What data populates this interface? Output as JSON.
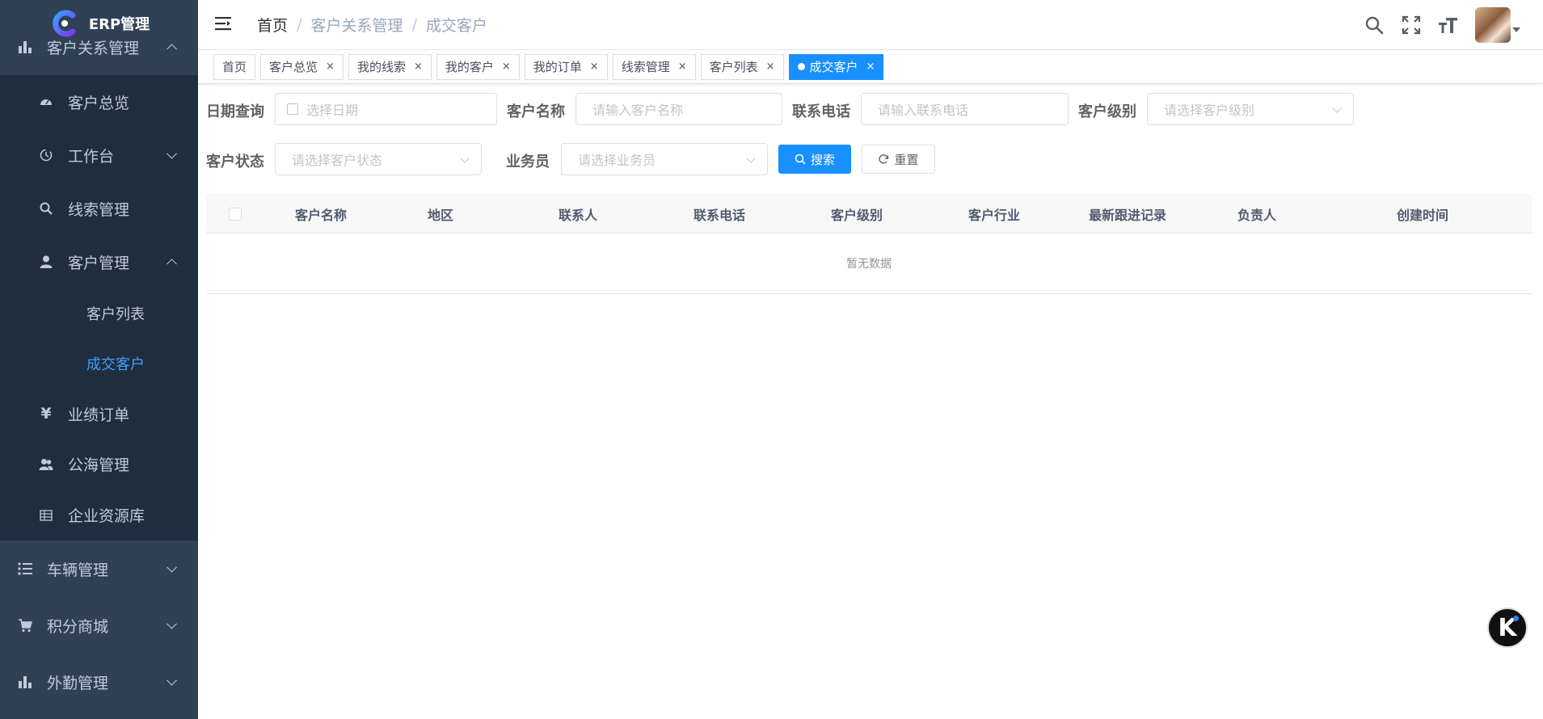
{
  "app": {
    "logo_text": "ERP管理"
  },
  "sidebar": {
    "items": [
      {
        "label": "客户关系管理",
        "icon": "bar-chart-icon",
        "level": "top",
        "expanded": true
      },
      {
        "label": "客户总览",
        "icon": "dashboard-icon",
        "level": "sub"
      },
      {
        "label": "工作台",
        "icon": "history-icon",
        "level": "sub",
        "collapsed": true
      },
      {
        "label": "线索管理",
        "icon": "search-icon",
        "level": "sub"
      },
      {
        "label": "客户管理",
        "icon": "user-icon",
        "level": "sub",
        "expanded": true
      },
      {
        "label": "客户列表",
        "level": "subsub"
      },
      {
        "label": "成交客户",
        "level": "subsub",
        "active": true
      },
      {
        "label": "业绩订单",
        "icon": "yen-icon",
        "level": "sub"
      },
      {
        "label": "公海管理",
        "icon": "users-icon",
        "level": "sub"
      },
      {
        "label": "企业资源库",
        "icon": "table-icon",
        "level": "sub"
      },
      {
        "label": "车辆管理",
        "icon": "list-icon",
        "level": "top"
      },
      {
        "label": "积分商城",
        "icon": "cart-icon",
        "level": "top"
      },
      {
        "label": "外勤管理",
        "icon": "bar-chart-icon",
        "level": "top"
      }
    ]
  },
  "breadcrumb": {
    "home": "首页",
    "level1": "客户关系管理",
    "level2": "成交客户",
    "separator": "/"
  },
  "tags": [
    {
      "label": "首页",
      "closable": false
    },
    {
      "label": "客户总览",
      "closable": true
    },
    {
      "label": "我的线索",
      "closable": true
    },
    {
      "label": "我的客户",
      "closable": true
    },
    {
      "label": "我的订单",
      "closable": true
    },
    {
      "label": "线索管理",
      "closable": true
    },
    {
      "label": "客户列表",
      "closable": true
    },
    {
      "label": "成交客户",
      "closable": true,
      "active": true
    }
  ],
  "tag_close_glyph": "×",
  "search": {
    "date_label": "日期查询",
    "date_placeholder": "选择日期",
    "name_label": "客户名称",
    "name_placeholder": "请输入客户名称",
    "phone_label": "联系电话",
    "phone_placeholder": "请输入联系电话",
    "level_label": "客户级别",
    "level_placeholder": "请选择客户级别",
    "status_label": "客户状态",
    "status_placeholder": "请选择客户状态",
    "salesman_label": "业务员",
    "salesman_placeholder": "请选择业务员",
    "search_button": "搜索",
    "reset_button": "重置"
  },
  "table": {
    "columns": [
      "客户名称",
      "地区",
      "联系人",
      "联系电话",
      "客户级别",
      "客户行业",
      "最新跟进记录",
      "负责人",
      "创建时间"
    ],
    "empty_text": "暂无数据"
  },
  "float_button": {
    "letter": "K"
  },
  "colors": {
    "sidebar_bg": "#304156",
    "submenu_bg": "#1f2d3d",
    "primary": "#1890ff",
    "active_text": "#409eff"
  }
}
